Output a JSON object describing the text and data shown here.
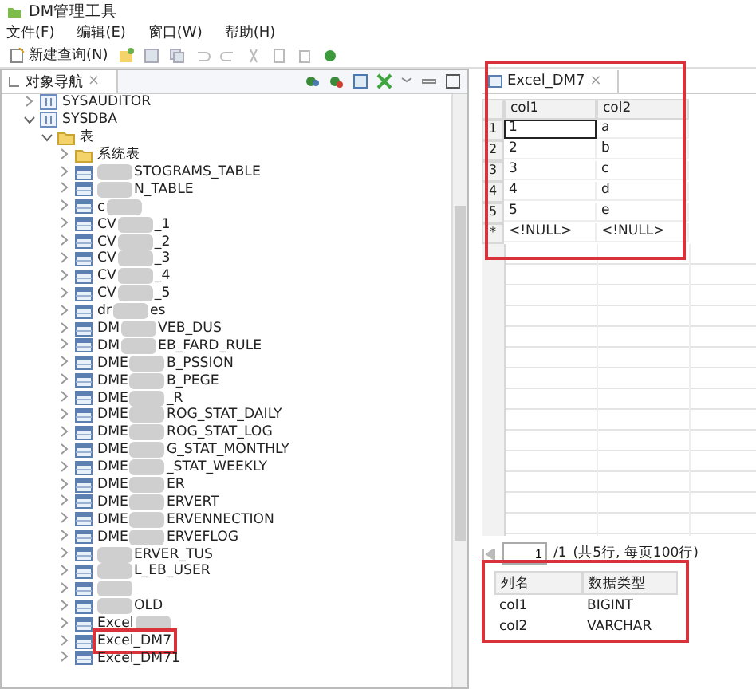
{
  "window": {
    "title": "DM管理工具"
  },
  "menu": [
    "文件(F)",
    "编辑(E)",
    "窗口(W)",
    "帮助(H)"
  ],
  "toolbar": {
    "new_query": "新建查询(N)"
  },
  "navigator": {
    "tab": "对象导航",
    "close": "×",
    "tree": [
      {
        "label": "SYSAUDITOR",
        "kind": "schema",
        "expanded": false
      },
      {
        "label": "SYSDBA",
        "kind": "schema",
        "expanded": true,
        "children": [
          {
            "label": "表",
            "kind": "folder",
            "expanded": true,
            "children": [
              {
                "head": "系统表",
                "kind": "folder",
                "redacted": false,
                "annotated": false
              },
              {
                "tail": "STOGRAMS_TABLE",
                "kind": "table",
                "redacted": true,
                "annotated": false
              },
              {
                "tail": "N_TABLE",
                "kind": "table",
                "redacted": true,
                "annotated": false
              },
              {
                "head": "c",
                "kind": "table",
                "redacted": true,
                "annotated": false
              },
              {
                "head": "CV",
                "tail": "_1",
                "kind": "table",
                "redacted": true,
                "annotated": false
              },
              {
                "head": "CV",
                "tail": "_2",
                "kind": "table",
                "redacted": true,
                "annotated": false
              },
              {
                "head": "CV",
                "tail": "_3",
                "kind": "table",
                "redacted": true,
                "annotated": false
              },
              {
                "head": "CV",
                "tail": "_4",
                "kind": "table",
                "redacted": true,
                "annotated": false
              },
              {
                "head": "CV",
                "tail": "_5",
                "kind": "table",
                "redacted": true,
                "annotated": false
              },
              {
                "head": "dr",
                "tail": "es",
                "kind": "table",
                "redacted": true,
                "annotated": false
              },
              {
                "head": "DM",
                "tail": "VEB_DUS",
                "kind": "table",
                "redacted": true,
                "annotated": false
              },
              {
                "head": "DM",
                "tail": "EB_FARD_RULE",
                "kind": "table",
                "redacted": true,
                "annotated": false
              },
              {
                "head": "DME",
                "tail": "B_PSSION",
                "kind": "table",
                "redacted": true,
                "annotated": false
              },
              {
                "head": "DME",
                "tail": "B_PEGE",
                "kind": "table",
                "redacted": true,
                "annotated": false
              },
              {
                "head": "DME",
                "tail": "_R",
                "kind": "table",
                "redacted": true,
                "annotated": false
              },
              {
                "head": "DME",
                "tail": "ROG_STAT_DAILY",
                "kind": "table",
                "redacted": true,
                "annotated": false
              },
              {
                "head": "DME",
                "tail": "ROG_STAT_LOG",
                "kind": "table",
                "redacted": true,
                "annotated": false
              },
              {
                "head": "DME",
                "tail": "G_STAT_MONTHLY",
                "kind": "table",
                "redacted": true,
                "annotated": false
              },
              {
                "head": "DME",
                "tail": "_STAT_WEEKLY",
                "kind": "table",
                "redacted": true,
                "annotated": false
              },
              {
                "head": "DME",
                "tail": "ER",
                "kind": "table",
                "redacted": true,
                "annotated": false
              },
              {
                "head": "DME",
                "tail": "ERVERT",
                "kind": "table",
                "redacted": true,
                "annotated": false
              },
              {
                "head": "DME",
                "tail": "ERVENNECTION",
                "kind": "table",
                "redacted": true,
                "annotated": false
              },
              {
                "head": "DME",
                "tail": "ERVEFLOG",
                "kind": "table",
                "redacted": true,
                "annotated": false
              },
              {
                "tail": "ERVER_TUS",
                "kind": "table",
                "redacted": true,
                "annotated": false
              },
              {
                "tail": "L_EB_USER",
                "kind": "table",
                "redacted": true,
                "annotated": false
              },
              {
                "kind": "table",
                "redacted": true,
                "annotated": false
              },
              {
                "tail": "OLD",
                "kind": "table",
                "redacted": true,
                "annotated": false
              },
              {
                "head": "Excel",
                "kind": "table",
                "redacted": true,
                "annotated": false
              },
              {
                "head": "Excel_DM7",
                "kind": "table",
                "redacted": false,
                "annotated": true
              },
              {
                "head": "Excel_DM71",
                "kind": "table",
                "redacted": false,
                "annotated": false
              }
            ]
          }
        ]
      }
    ]
  },
  "editor": {
    "tab": "Excel_DM7",
    "close": "×",
    "annotated": true,
    "columns": [
      "col1",
      "col2"
    ],
    "rows": [
      {
        "marker": "1",
        "cells": [
          "1",
          "a"
        ],
        "selected": true
      },
      {
        "marker": "2",
        "cells": [
          "2",
          "b"
        ],
        "selected": false
      },
      {
        "marker": "3",
        "cells": [
          "3",
          "c"
        ],
        "selected": false
      },
      {
        "marker": "4",
        "cells": [
          "4",
          "d"
        ],
        "selected": false
      },
      {
        "marker": "5",
        "cells": [
          "5",
          "e"
        ],
        "selected": false
      },
      {
        "marker": "*",
        "cells": [
          "<!NULL>",
          "<!NULL>"
        ],
        "selected": false
      }
    ],
    "pager": {
      "page": "1",
      "total": "/1",
      "summary": "(共5行, 每页100行)"
    }
  },
  "structure": {
    "annotated": true,
    "columns": [
      "列名",
      "数据类型"
    ],
    "rows": [
      [
        "col1",
        "BIGINT"
      ],
      [
        "col2",
        "VARCHAR"
      ]
    ]
  }
}
